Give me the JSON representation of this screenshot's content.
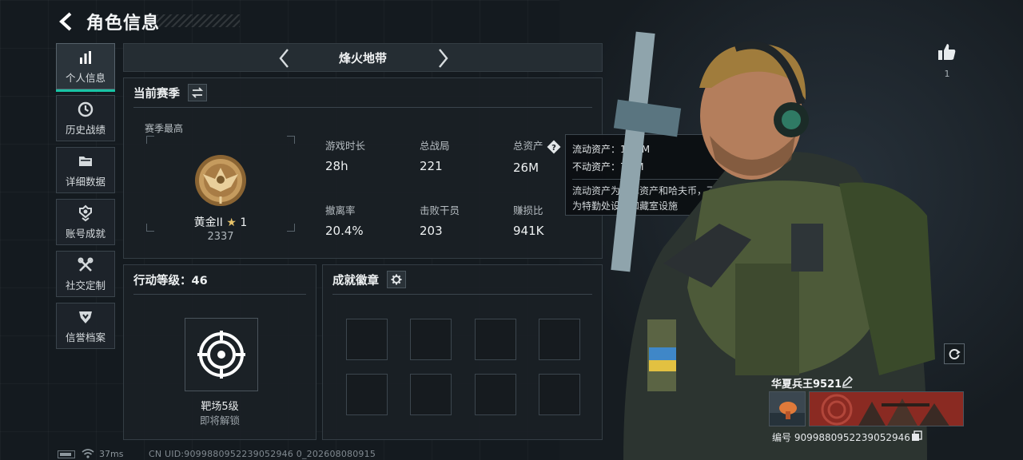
{
  "header": {
    "title": "角色信息"
  },
  "sidebar": {
    "items": [
      {
        "label": "个人信息",
        "icon": "bar-chart-icon",
        "active": true
      },
      {
        "label": "历史战绩",
        "icon": "history-icon"
      },
      {
        "label": "详细数据",
        "icon": "folder-icon"
      },
      {
        "label": "账号成就",
        "icon": "achievement-icon"
      },
      {
        "label": "社交定制",
        "icon": "tools-icon"
      },
      {
        "label": "信誉档案",
        "icon": "credit-icon"
      }
    ]
  },
  "map": {
    "name": "烽火地带"
  },
  "season": {
    "title": "当前赛季",
    "best_label": "赛季最高",
    "rank_name": "黄金II",
    "rank_stars": "★",
    "rank_star_count": "1",
    "rank_score": "2337",
    "stats": [
      {
        "label": "游戏时长",
        "value": "28h"
      },
      {
        "label": "总战局",
        "value": "221"
      },
      {
        "label": "总资产",
        "value": "26M"
      },
      {
        "label": "撤离率",
        "value": "20.4%"
      },
      {
        "label": "击败干员",
        "value": "203"
      },
      {
        "label": "赚损比",
        "value": "941K"
      }
    ]
  },
  "tooltip": {
    "liquid": "流动资产：18.8M",
    "fixed": "不动资产：7.2M",
    "desc_line1": "流动资产为仓库资产和哈夫币，不动资产",
    "desc_line2": "为特勤处设施和藏室设施"
  },
  "action_level": {
    "title": "行动等级：46",
    "item_name": "靶场5级",
    "item_status": "即将解锁"
  },
  "badges": {
    "title": "成就徽章",
    "slot_count": 8
  },
  "profile": {
    "likes": "1",
    "player_name": "华夏兵王9521",
    "player_id": "编号 9099880952239052946"
  },
  "footer": {
    "ping": "37ms",
    "uid": "CN UID:9099880952239052946 0_202608080915"
  },
  "colors": {
    "accent": "#19c3a5",
    "panel_bg": "#1a2025",
    "gold": "#c59b5e"
  }
}
